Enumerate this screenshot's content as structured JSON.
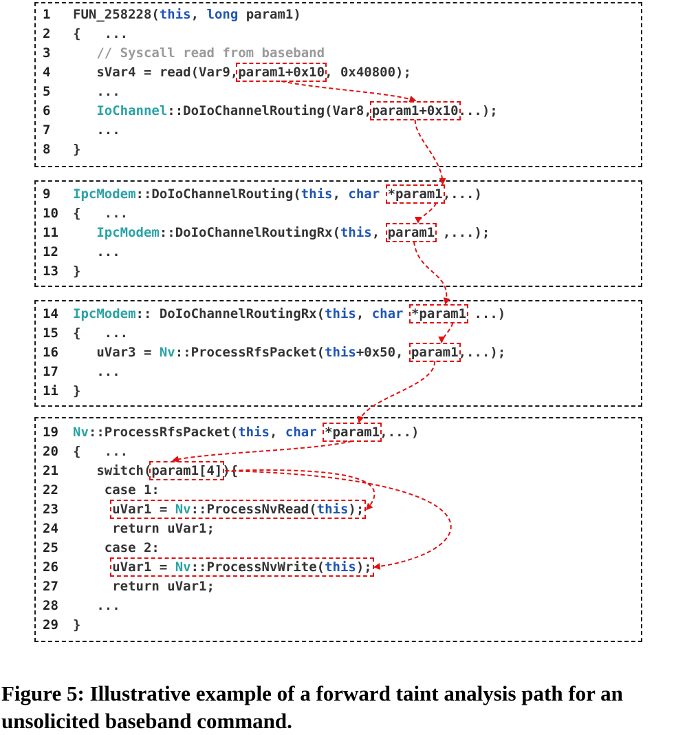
{
  "colors": {
    "keyword": "#1f55b5",
    "class": "#2aa2a6",
    "comment": "#9a9a9a",
    "plain": "#333333",
    "taint": "#e01010",
    "border": "#1a1a1a"
  },
  "blocks": [
    {
      "lines": [
        {
          "num": "1",
          "tokens": [
            {
              "t": "FUN_258228("
            },
            {
              "t": "this",
              "c": "kw"
            },
            {
              "t": ", "
            },
            {
              "t": "long",
              "c": "kw"
            },
            {
              "t": " param1)"
            }
          ]
        },
        {
          "num": "2",
          "tokens": [
            {
              "t": "{   ..."
            }
          ]
        },
        {
          "num": "3",
          "tokens": [
            {
              "t": "   // Syscall read from baseband",
              "c": "com"
            }
          ]
        },
        {
          "num": "4",
          "tokens": [
            {
              "t": "   sVar4 = read(Var9,"
            },
            {
              "t": "param1+0x10",
              "box": "t4"
            },
            {
              "t": ", 0x40800);"
            }
          ]
        },
        {
          "num": "5",
          "tokens": [
            {
              "t": "   ..."
            }
          ]
        },
        {
          "num": "6",
          "tokens": [
            {
              "t": "   "
            },
            {
              "t": "IoChannel",
              "c": "cls"
            },
            {
              "t": "::DoIoChannelRouting(Var8,"
            },
            {
              "t": "param1+0x10",
              "box": "t6"
            },
            {
              "t": "...);"
            }
          ]
        },
        {
          "num": "7",
          "tokens": [
            {
              "t": "   ..."
            }
          ]
        },
        {
          "num": "8",
          "tokens": [
            {
              "t": "}"
            }
          ]
        }
      ]
    },
    {
      "lines": [
        {
          "num": "9",
          "tokens": [
            {
              "t": "IpcModem",
              "c": "cls"
            },
            {
              "t": "::DoIoChannelRouting("
            },
            {
              "t": "this",
              "c": "kw"
            },
            {
              "t": ", "
            },
            {
              "t": "char",
              "c": "kw"
            },
            {
              "t": " "
            },
            {
              "t": "*param1",
              "box": "t9"
            },
            {
              "t": ",...)"
            }
          ]
        },
        {
          "num": "10",
          "tokens": [
            {
              "t": "{   ..."
            }
          ]
        },
        {
          "num": "11",
          "tokens": [
            {
              "t": "   "
            },
            {
              "t": "IpcModem",
              "c": "cls"
            },
            {
              "t": "::DoIoChannelRoutingRx("
            },
            {
              "t": "this",
              "c": "kw"
            },
            {
              "t": ", "
            },
            {
              "t": "param1",
              "box": "t11"
            },
            {
              "t": " ,...);"
            }
          ]
        },
        {
          "num": "12",
          "tokens": [
            {
              "t": "   ..."
            }
          ]
        },
        {
          "num": "13",
          "tokens": [
            {
              "t": "}"
            }
          ]
        }
      ]
    },
    {
      "lines": [
        {
          "num": "14",
          "tokens": [
            {
              "t": "IpcModem",
              "c": "cls"
            },
            {
              "t": ":: DoIoChannelRoutingRx("
            },
            {
              "t": "this",
              "c": "kw"
            },
            {
              "t": ", "
            },
            {
              "t": "char",
              "c": "kw"
            },
            {
              "t": " "
            },
            {
              "t": "*param1",
              "box": "t14"
            },
            {
              "t": " ...)"
            }
          ]
        },
        {
          "num": "15",
          "tokens": [
            {
              "t": "{   ..."
            }
          ]
        },
        {
          "num": "16",
          "tokens": [
            {
              "t": "   uVar3 = "
            },
            {
              "t": "Nv",
              "c": "cls"
            },
            {
              "t": "::ProcessRfsPacket("
            },
            {
              "t": "this",
              "c": "kw"
            },
            {
              "t": "+0x50, "
            },
            {
              "t": "param1",
              "box": "t16"
            },
            {
              "t": ",...);"
            }
          ]
        },
        {
          "num": "17",
          "tokens": [
            {
              "t": "   ..."
            }
          ]
        },
        {
          "num": "1i",
          "tokens": [
            {
              "t": "}"
            }
          ]
        }
      ]
    },
    {
      "lines": [
        {
          "num": "19",
          "tokens": [
            {
              "t": "Nv",
              "c": "cls"
            },
            {
              "t": "::ProcessRfsPacket("
            },
            {
              "t": "this",
              "c": "kw"
            },
            {
              "t": ", "
            },
            {
              "t": "char",
              "c": "kw"
            },
            {
              "t": " "
            },
            {
              "t": "*param1",
              "box": "t19"
            },
            {
              "t": ",...)"
            }
          ]
        },
        {
          "num": "20",
          "tokens": [
            {
              "t": "{   ..."
            }
          ]
        },
        {
          "num": "21",
          "tokens": [
            {
              "t": "   switch("
            },
            {
              "t": "param1[4]",
              "box": "t21"
            },
            {
              "t": "){"
            }
          ]
        },
        {
          "num": "22",
          "tokens": [
            {
              "t": "    case 1:"
            }
          ]
        },
        {
          "num": "23",
          "tokens": [
            {
              "t": "     "
            },
            {
              "t": "uVar1 = ",
              "box": "t23"
            },
            {
              "t": "Nv",
              "c": "cls",
              "box": "t23"
            },
            {
              "t": "::ProcessNvRead(",
              "box": "t23"
            },
            {
              "t": "this",
              "c": "kw",
              "box": "t23"
            },
            {
              "t": ");",
              "box": "t23"
            }
          ]
        },
        {
          "num": "24",
          "tokens": [
            {
              "t": "     return uVar1;"
            }
          ]
        },
        {
          "num": "25",
          "tokens": [
            {
              "t": "    case 2:"
            }
          ]
        },
        {
          "num": "26",
          "tokens": [
            {
              "t": "     "
            },
            {
              "t": "uVar1 = ",
              "box": "t26"
            },
            {
              "t": "Nv",
              "c": "cls",
              "box": "t26"
            },
            {
              "t": "::ProcessNvWrite(",
              "box": "t26"
            },
            {
              "t": "this",
              "c": "kw",
              "box": "t26"
            },
            {
              "t": ");",
              "box": "t26"
            }
          ]
        },
        {
          "num": "27",
          "tokens": [
            {
              "t": "     return uVar1;"
            }
          ]
        },
        {
          "num": "28",
          "tokens": [
            {
              "t": "   ..."
            }
          ]
        },
        {
          "num": "29",
          "tokens": [
            {
              "t": "}"
            }
          ]
        }
      ]
    }
  ],
  "caption": "Figure 5: Illustrative example of a forward taint analysis path for an unsolicited baseband command."
}
